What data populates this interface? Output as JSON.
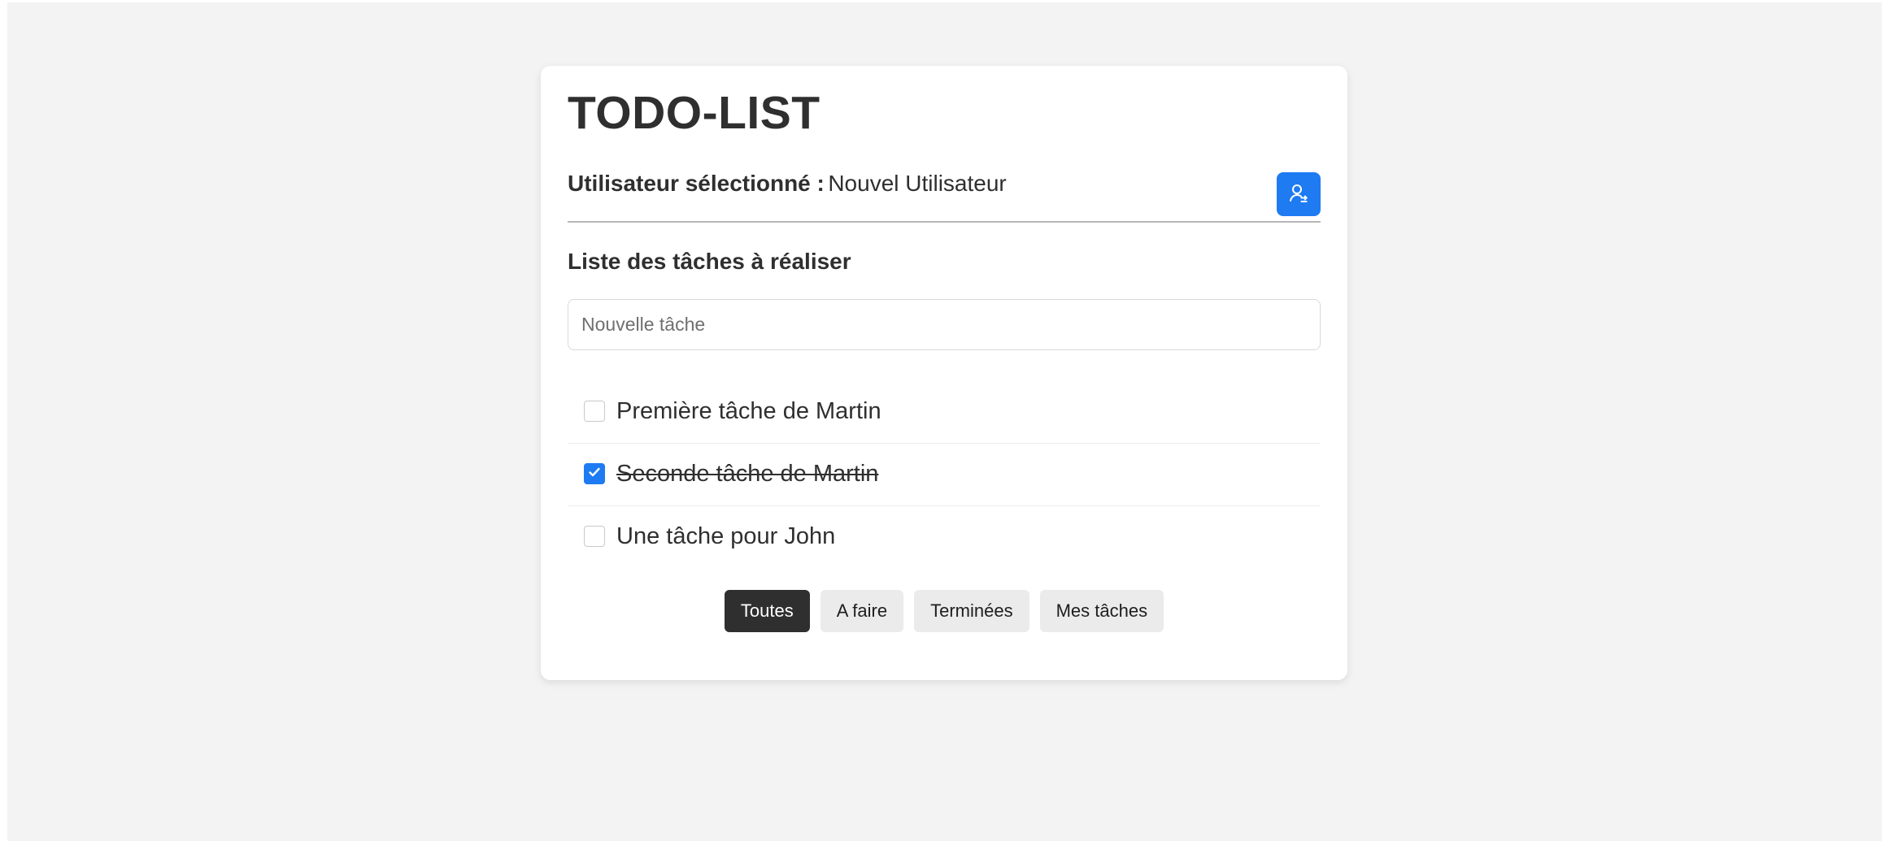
{
  "app": {
    "title": "TODO-LIST"
  },
  "user": {
    "label": "Utilisateur sélectionné :",
    "value": "Nouvel Utilisateur",
    "button_icon": "user-switch-icon"
  },
  "tasks_section": {
    "title": "Liste des tâches à réaliser",
    "new_task_placeholder": "Nouvelle tâche",
    "new_task_value": ""
  },
  "tasks": [
    {
      "label": "Première tâche de Martin",
      "done": false
    },
    {
      "label": "Seconde tâche de Martin",
      "done": true
    },
    {
      "label": "Une tâche pour John",
      "done": false
    }
  ],
  "filters": [
    {
      "label": "Toutes",
      "active": true
    },
    {
      "label": "A faire",
      "active": false
    },
    {
      "label": "Terminées",
      "active": false
    },
    {
      "label": "Mes tâches",
      "active": false
    }
  ],
  "colors": {
    "accent": "#1e7bf2",
    "text": "#2f2f2f",
    "background": "#f3f3f3",
    "card": "#ffffff",
    "active_filter": "#2f2f2f"
  }
}
